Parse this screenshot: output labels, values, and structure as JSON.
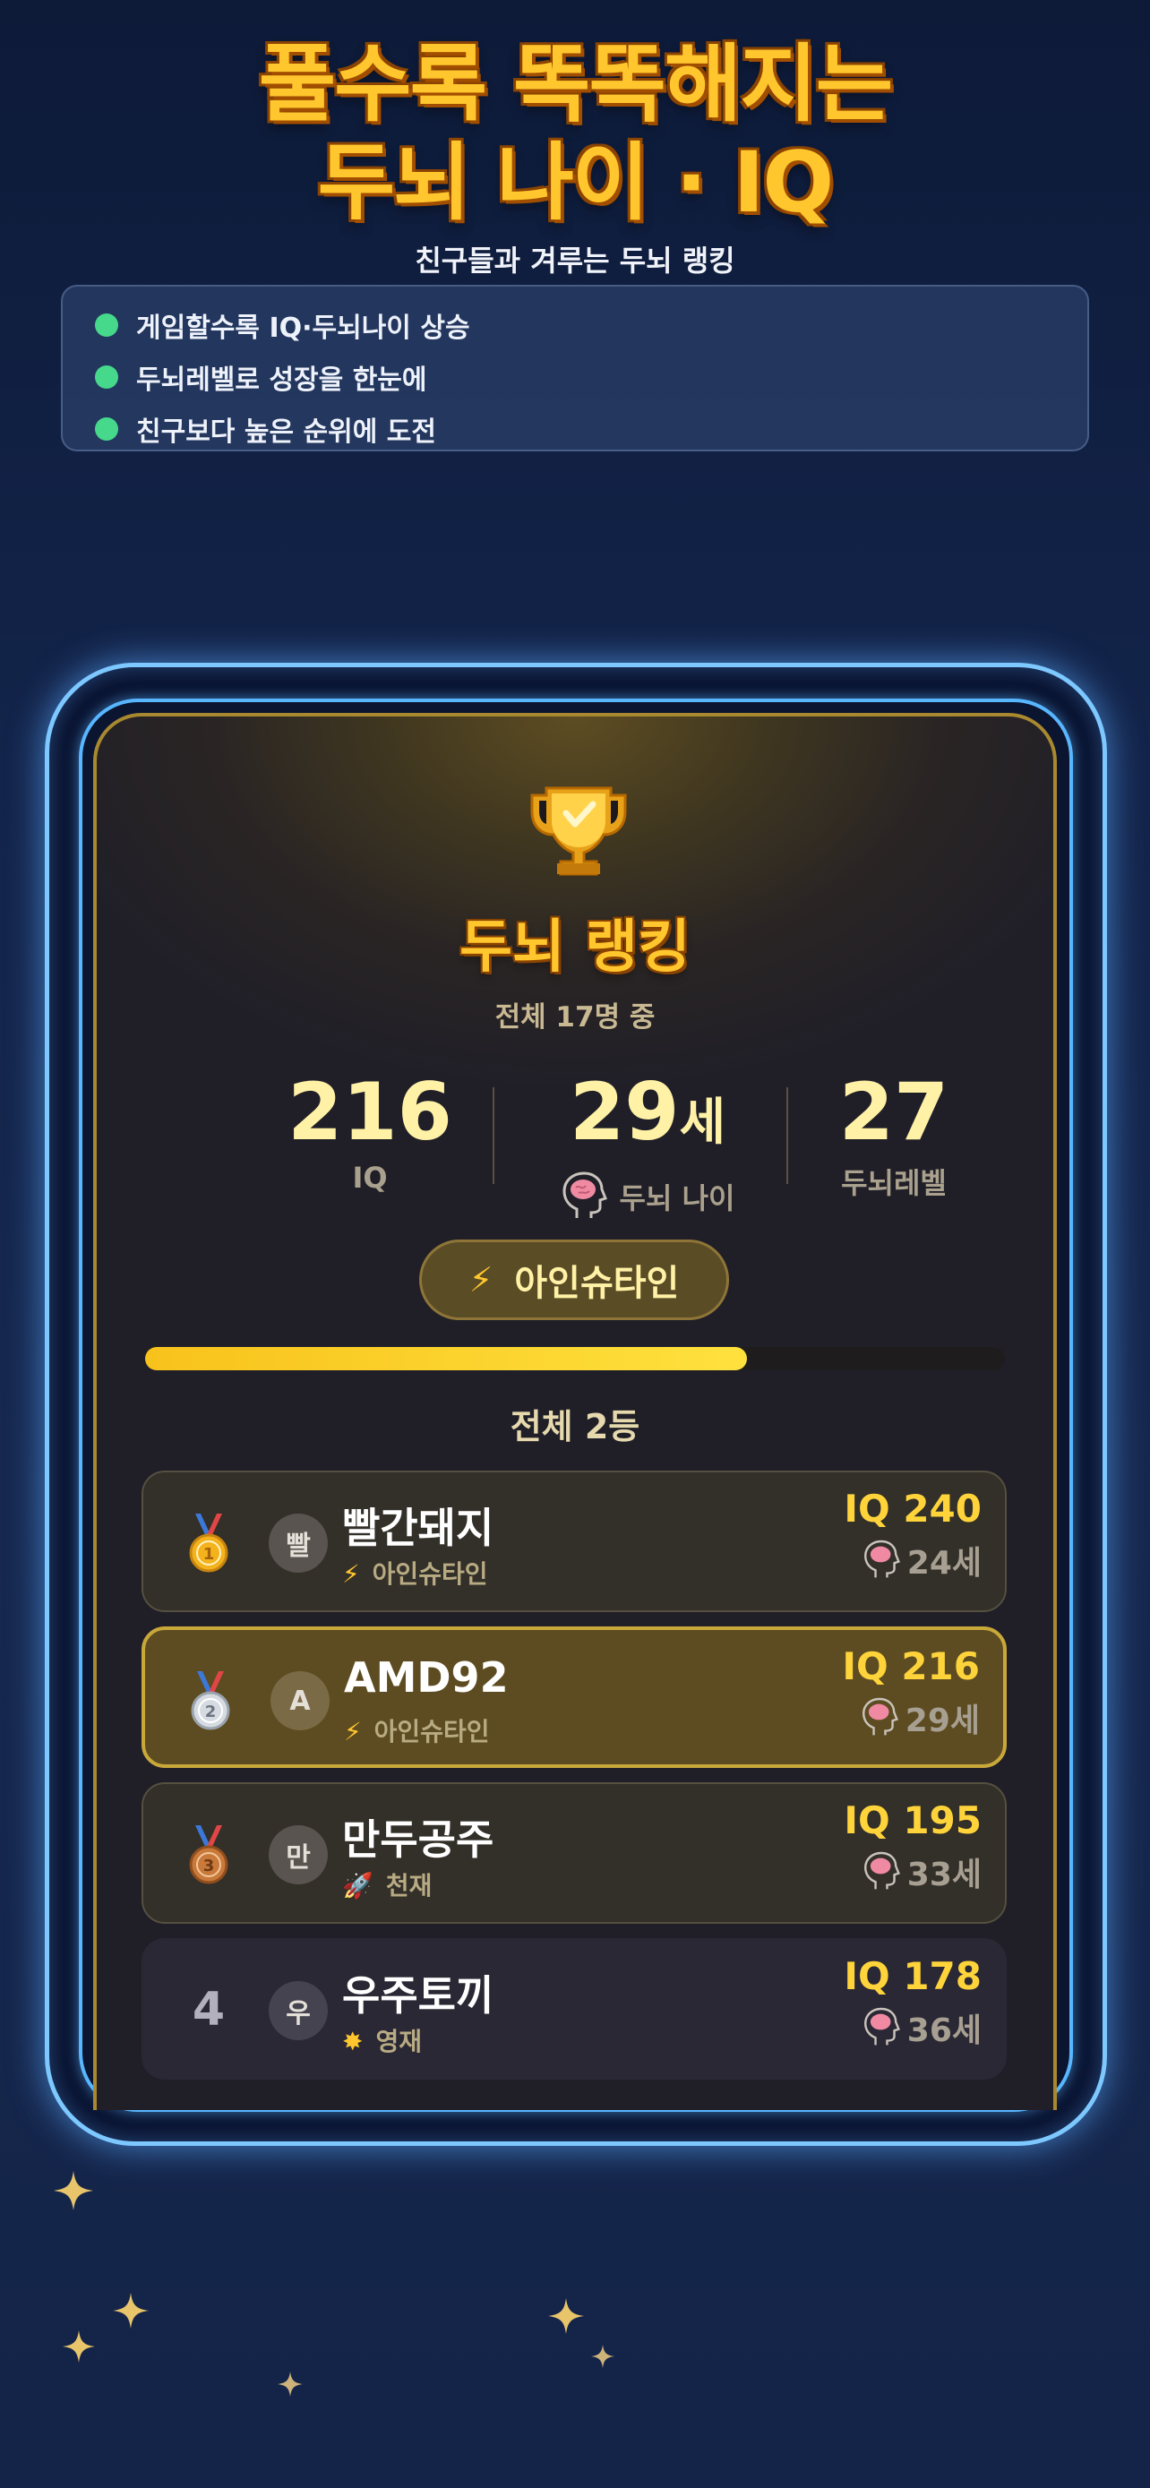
{
  "headline": {
    "line1": "풀수록 똑똑해지는",
    "line2": "두뇌 나이 · IQ",
    "subtitle": "친구들과 겨루는 두뇌 랭킹"
  },
  "features": [
    "게임할수록 IQ·두뇌나이 상승",
    "두뇌레벨로 성장을 한눈에",
    "친구보다 높은 순위에 도전"
  ],
  "card": {
    "title": "두뇌 랭킹",
    "total": "전체 17명 중",
    "stats": {
      "iq_value": "216",
      "iq_label": "IQ",
      "age_value": "29",
      "age_suffix": "세",
      "age_label": "두뇌 나이",
      "level_value": "27",
      "level_label": "두뇌레벨"
    },
    "badge": "아인슈타인",
    "progress_fraction": 0.7,
    "rank_text": "전체 2등"
  },
  "ranking": [
    {
      "rank": "1",
      "avatar": "빨",
      "name": "빨간돼지",
      "tier_icon": "⚡",
      "tier": "아인슈타인",
      "iq": "IQ 240",
      "age": "24세"
    },
    {
      "rank": "2",
      "avatar": "A",
      "name": "AMD92",
      "tier_icon": "⚡",
      "tier": "아인슈타인",
      "iq": "IQ 216",
      "age": "29세"
    },
    {
      "rank": "3",
      "avatar": "만",
      "name": "만두공주",
      "tier_icon": "🚀",
      "tier": "천재",
      "iq": "IQ 195",
      "age": "33세"
    },
    {
      "rank": "4",
      "avatar": "우",
      "name": "우주토끼",
      "tier_icon": "✸",
      "tier": "영재",
      "iq": "IQ 178",
      "age": "36세"
    }
  ],
  "colors": {
    "accent_gold": "#ffc62d",
    "frame_blue": "#7cc8ff",
    "feature_dot": "#46d98b"
  }
}
